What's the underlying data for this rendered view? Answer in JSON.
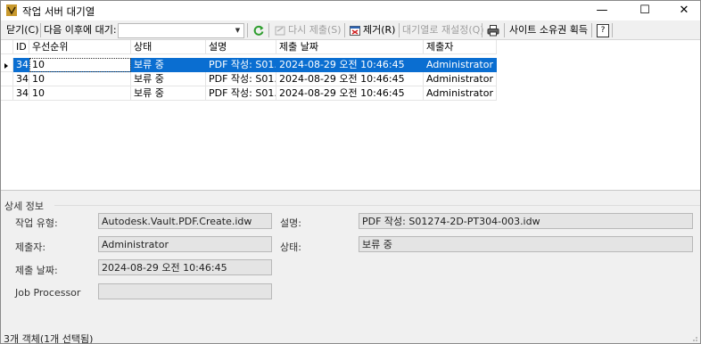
{
  "window": {
    "title": "작업 서버 대기열",
    "minimize_glyph": "—",
    "maximize_glyph": "☐",
    "close_glyph": "✕"
  },
  "toolbar": {
    "close": "닫기(C)",
    "next_wait_label": "다음 이후에 대기:",
    "next_wait_value": "",
    "refresh_icon": "refresh-icon",
    "resubmit": "다시 제출(S)",
    "remove": "제거(R)",
    "reschedule": "대기열로 재설정(Q)",
    "print_icon": "print-icon",
    "take_ownership": "사이트 소유권 획득",
    "help_glyph": "?"
  },
  "grid": {
    "columns": [
      "ID",
      "우선순위",
      "상태",
      "설명",
      "제출 날짜",
      "제출자"
    ],
    "rows": [
      [
        "34",
        "10",
        "보류 중",
        "PDF 작성: S01...",
        "2024-08-29 오전 10:46:45",
        "Administrator"
      ],
      [
        "34",
        "10",
        "보류 중",
        "PDF 작성: S01...",
        "2024-08-29 오전 10:46:45",
        "Administrator"
      ],
      [
        "34",
        "10",
        "보류 중",
        "PDF 작성: S01...",
        "2024-08-29 오전 10:46:45",
        "Administrator"
      ]
    ],
    "selected_row_index": 0,
    "selection_color": "#0a6ed1"
  },
  "details": {
    "section_title": "상세 정보",
    "job_type_label": "작업 유형:",
    "job_type_value": "Autodesk.Vault.PDF.Create.idw",
    "description_label": "설명:",
    "description_value": "PDF 작성: S01274-2D-PT304-003.idw",
    "submitter_label": "제출자:",
    "submitter_value": "Administrator",
    "status_label": "상태:",
    "status_value": "보류 중",
    "submit_date_label": "제출 날짜:",
    "submit_date_value": "2024-08-29 오전 10:46:45",
    "job_processor_label": "Job Processor",
    "job_processor_value": ""
  },
  "status_bar": {
    "text": "3개 객체(1개 선택됨)"
  }
}
